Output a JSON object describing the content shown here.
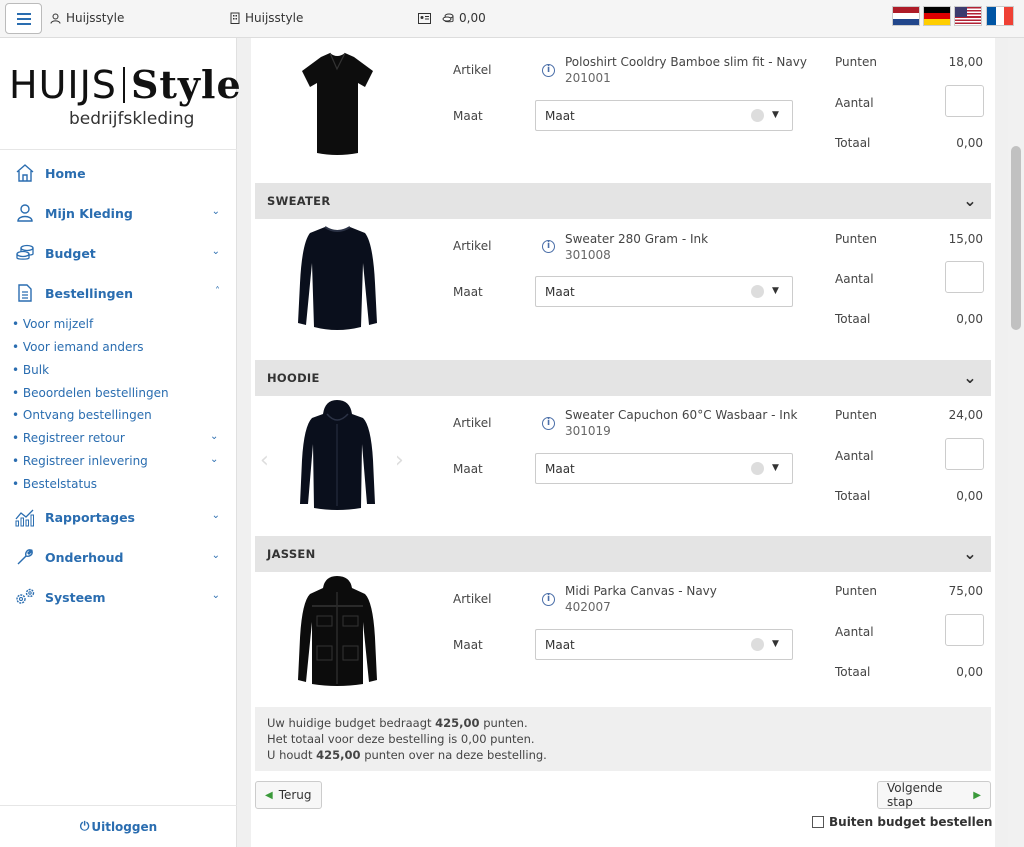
{
  "topbar": {
    "user": "Huijsstyle",
    "company": "Huijsstyle",
    "balance": "0,00",
    "flags": [
      "nl-flag-icon",
      "de-flag-icon",
      "us-flag-icon",
      "fr-flag-icon"
    ]
  },
  "logo": {
    "main_a": "HUIJS",
    "main_b": "Style",
    "sub": "bedrijfskleding"
  },
  "sidebar": {
    "items": [
      {
        "label": "Home",
        "icon": "home-icon"
      },
      {
        "label": "Mijn Kleding",
        "icon": "user-icon"
      },
      {
        "label": "Budget",
        "icon": "coins-icon"
      },
      {
        "label": "Bestellingen",
        "icon": "document-icon"
      },
      {
        "label": "Rapportages",
        "icon": "chart-icon"
      },
      {
        "label": "Onderhoud",
        "icon": "wrench-icon"
      },
      {
        "label": "Systeem",
        "icon": "gears-icon"
      }
    ],
    "subitems": [
      "• Voor mijzelf",
      "• Voor iemand anders",
      "• Bulk",
      "• Beoordelen bestellingen",
      "• Ontvang bestellingen",
      "• Registreer retour",
      "• Registreer inlevering",
      "• Bestelstatus"
    ],
    "logout": "Uitloggen"
  },
  "labels": {
    "artikel": "Artikel",
    "maat": "Maat",
    "punten": "Punten",
    "aantal": "Aantal",
    "totaal": "Totaal"
  },
  "sections": [
    {
      "title": "",
      "product": {
        "name": "Poloshirt Cooldry Bamboe slim fit - Navy",
        "code": "201001",
        "size_placeholder": "Maat",
        "punten": "18,00",
        "totaal": "0,00"
      }
    },
    {
      "title": "SWEATER",
      "product": {
        "name": "Sweater 280 Gram - Ink",
        "code": "301008",
        "size_placeholder": "Maat",
        "punten": "15,00",
        "totaal": "0,00"
      }
    },
    {
      "title": "HOODIE",
      "product": {
        "name": "Sweater Capuchon 60°C Wasbaar - Ink",
        "code": "301019",
        "size_placeholder": "Maat",
        "punten": "24,00",
        "totaal": "0,00"
      }
    },
    {
      "title": "JASSEN",
      "product": {
        "name": "Midi Parka Canvas - Navy",
        "code": "402007",
        "size_placeholder": "Maat",
        "punten": "75,00",
        "totaal": "0,00"
      }
    }
  ],
  "summary": {
    "l1a": "Uw huidige budget bedraagt ",
    "l1b": "425,00",
    "l1c": " punten.",
    "l2": "Het totaal voor deze bestelling is 0,00 punten.",
    "l3a": "U houdt ",
    "l3b": "425,00",
    "l3c": " punten over na deze bestelling."
  },
  "buttons": {
    "back": "Terug",
    "next": "Volgende stap",
    "outside_budget": "Buiten budget bestellen"
  }
}
